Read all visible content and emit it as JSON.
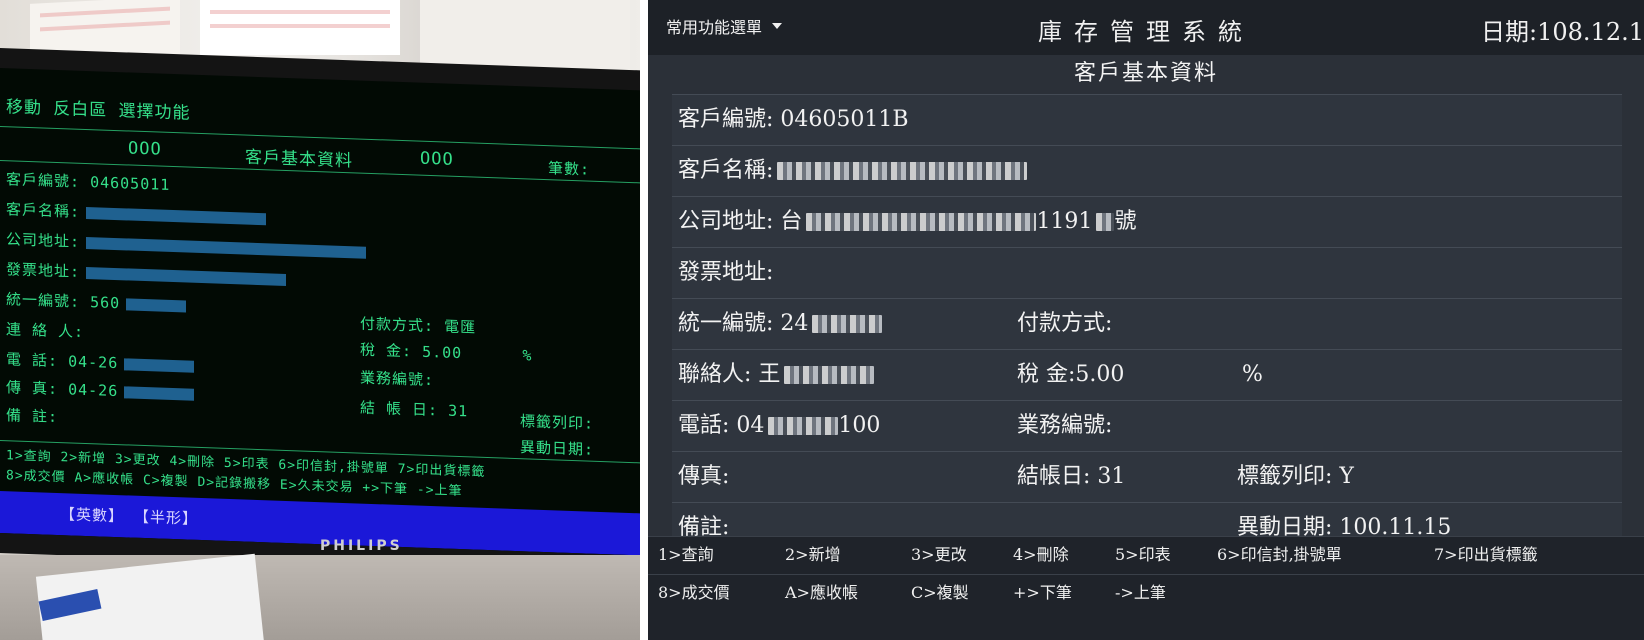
{
  "photo": {
    "terminal": {
      "top_line": "移動 反白區 選擇功能",
      "header": {
        "left_mark": "OOO",
        "title": "客戶基本資料",
        "right_mark": "OOO",
        "count_label": "筆數:"
      },
      "fields": {
        "customer_no_label": "客戶編號:",
        "customer_no_value": "04605011",
        "customer_name_label": "客戶名稱:",
        "company_address_label": "公司地址:",
        "invoice_address_label": "發票地址:",
        "unified_no_label": "統一編號:",
        "unified_no_value": "560",
        "contact_label": "連 絡 人:",
        "phone_label": "電    話:",
        "phone_value": "04-26",
        "fax_label": "傳    真:",
        "fax_value": "04-26",
        "note_label": "備    註:",
        "payment_label": "付款方式:",
        "payment_value": "電匯",
        "tax_label": "稅    金:",
        "tax_value": "5.00",
        "tax_unit": "%",
        "sales_no_label": "業務編號:",
        "closing_day_label": "結 帳 日:",
        "closing_day_value": "31",
        "label_print_label": "標籤列印:",
        "modified_date_label": "異動日期:"
      },
      "func_row1": "1>查詢  2>新增  3>更改  4>刪除  5>印表  6>印信封,掛號單  7>印出貨標籤",
      "func_row2": "8>成交價  A>應收帳  C>複製  D>記錄搬移  E>久未交易  +>下筆  ->上筆",
      "status": "【英數】 【半形】"
    },
    "monitor_brand": "PHILIPS"
  },
  "app": {
    "menu_label": "常用功能選單",
    "title": "庫存管理系統",
    "date": "日期:108.12.1",
    "subtitle": "客戶基本資料",
    "fields": {
      "customer_no_label": "客戶編號:",
      "customer_no_value": "04605011B",
      "customer_name_label": "客戶名稱:",
      "company_address_label": "公司地址:",
      "company_address_value_start": "台",
      "company_address_value_mid": "1191",
      "company_address_value_end": "號",
      "invoice_address_label": "發票地址:",
      "unified_no_label": "統一編號:",
      "unified_no_value": "24",
      "payment_label": "付款方式:",
      "contact_label": "聯絡人:",
      "contact_value": "王",
      "tax_label": "稅 金:",
      "tax_value": "5.00",
      "tax_unit": "%",
      "phone_label": "電話:",
      "phone_value_start": "04",
      "phone_value_end": "100",
      "sales_no_label": "業務編號:",
      "fax_label": "傳真:",
      "closing_day_label": "結帳日:",
      "closing_day_value": "31",
      "label_print_label": "標籤列印:",
      "label_print_value": "Y",
      "note_label": "備註:",
      "modified_date_label": "異動日期:",
      "modified_date_value": "100.11.15"
    },
    "functions_row1": [
      "1>查詢",
      "2>新增",
      "3>更改",
      "4>刪除",
      "5>印表",
      "6>印信封,掛號單",
      "7>印出貨標籤"
    ],
    "functions_row2": [
      "8>成交價",
      "A>應收帳",
      "C>複製",
      "+>下筆",
      "->上筆"
    ],
    "colors": {
      "background": "#2b3038",
      "topbar": "#1d2127",
      "terminal_text": "#35e08a",
      "terminal_status": "#1b18d8"
    }
  }
}
